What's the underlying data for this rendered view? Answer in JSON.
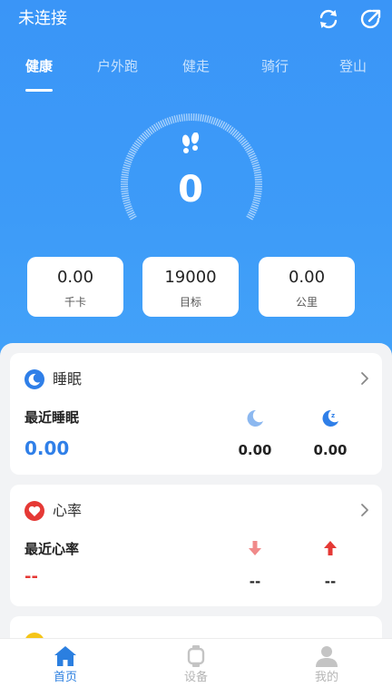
{
  "header": {
    "connection_status": "未连接"
  },
  "tabs": [
    {
      "label": "健康",
      "active": true
    },
    {
      "label": "户外跑",
      "active": false
    },
    {
      "label": "健走",
      "active": false
    },
    {
      "label": "骑行",
      "active": false
    },
    {
      "label": "登山",
      "active": false
    }
  ],
  "steps": {
    "value": "0"
  },
  "stats": [
    {
      "value": "0.00",
      "label": "千卡"
    },
    {
      "value": "19000",
      "label": "目标"
    },
    {
      "value": "0.00",
      "label": "公里"
    }
  ],
  "sleep_card": {
    "title": "睡眠",
    "subtitle": "最近睡眠",
    "main_value": "0.00",
    "light_value": "0.00",
    "deep_value": "0.00"
  },
  "heart_card": {
    "title": "心率",
    "subtitle": "最近心率",
    "main_value": "--",
    "min_value": "--",
    "max_value": "--"
  },
  "nav": [
    {
      "label": "首页",
      "active": true
    },
    {
      "label": "设备",
      "active": false
    },
    {
      "label": "我的",
      "active": false
    }
  ],
  "colors": {
    "primary": "#3a95f7",
    "heart": "#e53935",
    "nav_active": "#2b7fe0",
    "nav_inactive": "#b5b5b5"
  }
}
